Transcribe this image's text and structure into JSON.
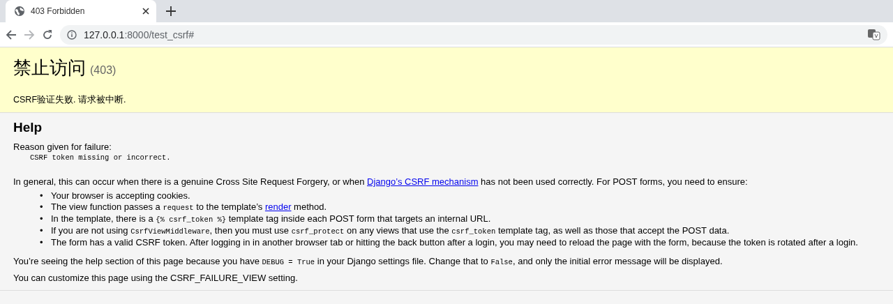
{
  "browser": {
    "tab": {
      "title": "403 Forbidden",
      "selected": true
    },
    "address": {
      "host": "127.0.0.1",
      "path": ":8000/test_csrf#"
    }
  },
  "summary": {
    "title": "禁止访问",
    "code": "(403)",
    "message": "CSRF验证失败. 请求被中断."
  },
  "help": {
    "heading": "Help",
    "reason_label": "Reason given for failure:",
    "reason": "CSRF token missing or incorrect.",
    "intro": [
      {
        "kind": "text",
        "text": "In general, this can occur when there is a genuine Cross Site Request Forgery, or when "
      },
      {
        "kind": "link",
        "text": "Django’s CSRF mechanism"
      },
      {
        "kind": "text",
        "text": " has not been used correctly. For POST forms, you need to ensure:"
      }
    ],
    "items": [
      {
        "bullet": "•",
        "parts": [
          {
            "kind": "text",
            "text": "Your browser is accepting cookies."
          }
        ]
      },
      {
        "bullet": "•",
        "parts": [
          {
            "kind": "text",
            "text": "The view function passes a "
          },
          {
            "kind": "code",
            "text": "request"
          },
          {
            "kind": "text",
            "text": " to the template’s "
          },
          {
            "kind": "link",
            "text": "render"
          },
          {
            "kind": "text",
            "text": " method."
          }
        ]
      },
      {
        "bullet": "•",
        "parts": [
          {
            "kind": "text",
            "text": "In the template, there is a "
          },
          {
            "kind": "code",
            "text": "{% csrf_token %}"
          },
          {
            "kind": "text",
            "text": " template tag inside each POST form that targets an internal URL."
          }
        ]
      },
      {
        "bullet": "•",
        "parts": [
          {
            "kind": "text",
            "text": "If you are not using "
          },
          {
            "kind": "code",
            "text": "CsrfViewMiddleware"
          },
          {
            "kind": "text",
            "text": ", then you must use "
          },
          {
            "kind": "code",
            "text": "csrf_protect"
          },
          {
            "kind": "text",
            "text": " on any views that use the "
          },
          {
            "kind": "code",
            "text": "csrf_token"
          },
          {
            "kind": "text",
            "text": " template tag, as well as those that accept the POST data."
          }
        ]
      },
      {
        "bullet": "•",
        "parts": [
          {
            "kind": "text",
            "text": "The form has a valid CSRF token. After logging in in another browser tab or hitting the back button after a login, you may need to reload the page with the form, because the token is rotated after a login."
          }
        ]
      }
    ],
    "notes": [
      [
        {
          "kind": "text",
          "text": "You’re seeing the help section of this page because you have "
        },
        {
          "kind": "code",
          "text": "DEBUG = True"
        },
        {
          "kind": "text",
          "text": " in your Django settings file. Change that to "
        },
        {
          "kind": "code",
          "text": "False"
        },
        {
          "kind": "text",
          "text": ", and only the initial error message will be displayed."
        }
      ],
      [
        {
          "kind": "text",
          "text": "You can customize this page using the CSRF_FAILURE_VIEW setting."
        }
      ]
    ]
  }
}
